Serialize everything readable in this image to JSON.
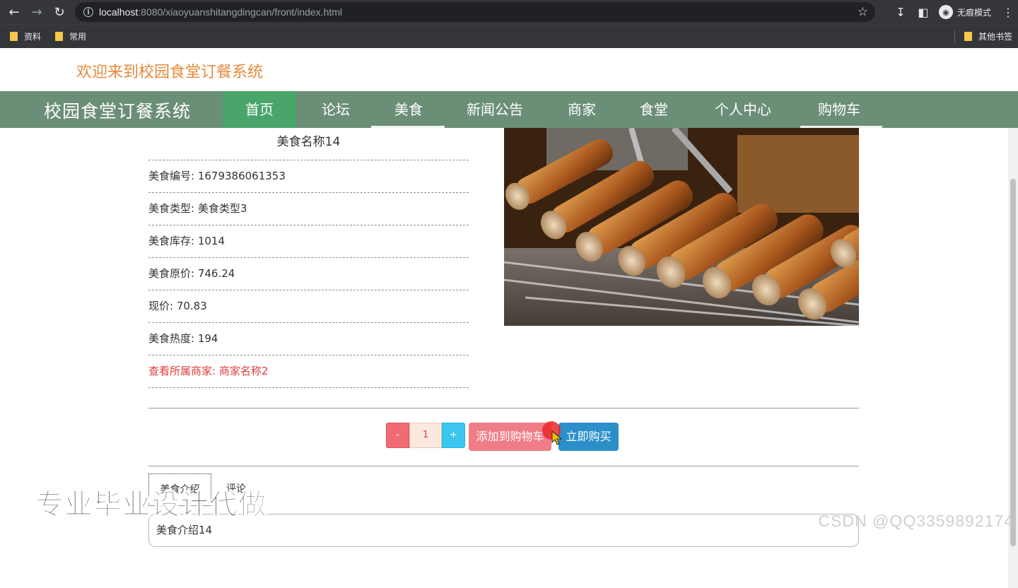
{
  "browser": {
    "url_host": "localhost",
    "url_path": ":8080/xiaoyuanshitangdingcan/front/index.html",
    "incognito_label": "无痕模式",
    "bookmarks": [
      "资料",
      "常用",
      "其他书签"
    ]
  },
  "header": {
    "welcome": "欢迎来到校园食堂订餐系统",
    "brand": "校园食堂订餐系统",
    "nav": [
      "首页",
      "论坛",
      "美食",
      "新闻公告",
      "商家",
      "食堂",
      "个人中心",
      "购物车"
    ],
    "active_nav": "首页"
  },
  "food": {
    "title": "美食名称14",
    "rows": [
      "美食编号: 1679386061353",
      "美食类型: 美食类型3",
      "美食库存: 1014",
      "美食原价: 746.24",
      "现价: 70.83",
      "美食热度: 194"
    ],
    "merchant_link": "查看所属商家: 商家名称2",
    "photo_icon": "grilled-mushroom-skewers-photo"
  },
  "cart": {
    "minus": "-",
    "quantity": "1",
    "plus": "+",
    "add_to_cart": "添加到购物车",
    "buy_now": "立即购买"
  },
  "tabs": {
    "intro": "美食介绍",
    "comment": "评论"
  },
  "intro_text": "美食介绍14",
  "watermarks": {
    "left": "专业毕业设计代做",
    "right": "CSDN @QQ3359892174"
  },
  "colors": {
    "navbar": "#6b8e77",
    "nav_active": "#4aa56a",
    "welcome": "#e58a3b",
    "merchant_link": "#e03b3b",
    "add_cart": "#f07c86",
    "buy_now": "#2b8fc9"
  }
}
